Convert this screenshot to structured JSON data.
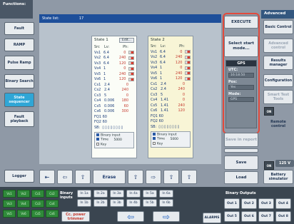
{
  "left_panel": {
    "title": "Functions:",
    "buttons": [
      "Fault",
      "RAMP",
      "Pulse Ramp",
      "Binary Search",
      "State sequencer",
      "Fault playback"
    ],
    "logger": "Logger"
  },
  "status_bar": {
    "label": "State list:",
    "value": "17"
  },
  "states": [
    {
      "title": "State 1",
      "edit": "Edit...",
      "headers": [
        "Src",
        "Lv:",
        "Ph:"
      ],
      "rows": [
        [
          "Vs1",
          "6.4",
          "0"
        ],
        [
          "Vs2",
          "6.4",
          "240"
        ],
        [
          "Vs3",
          "6.4",
          "120"
        ],
        [
          "Vs4",
          "1",
          "0"
        ],
        [
          "Vs5",
          "1",
          "240"
        ],
        [
          "Vs6",
          "1",
          "120"
        ],
        [
          "Cs1",
          "2.4",
          "0"
        ],
        [
          "Cs2",
          "2.4",
          "240"
        ],
        [
          "Cs3",
          "5",
          "0"
        ],
        [
          "Cs4",
          "0.006",
          "180"
        ],
        [
          "Cs5",
          "0.006",
          "60"
        ],
        [
          "Cs6",
          "0.006",
          "300"
        ]
      ],
      "fq": [
        "FQ1  60",
        "FQ2  60"
      ],
      "sb_label": "SB:",
      "binary_input": "Binary input",
      "time_label": "Time",
      "time_value": "5000",
      "key_label": "Key"
    },
    {
      "title": "State 2",
      "edit": "",
      "headers": [
        "Src",
        "Lv:",
        "Ph:"
      ],
      "rows": [
        [
          "Vs1",
          "6.4",
          "0"
        ],
        [
          "Vs2",
          "6.4",
          "240"
        ],
        [
          "Vs3",
          "6.4",
          "120"
        ],
        [
          "Vs4",
          "1",
          "0"
        ],
        [
          "Vs5",
          "1",
          "240"
        ],
        [
          "Vs6",
          "1",
          "120"
        ],
        [
          "Cs1",
          "2.4",
          "0"
        ],
        [
          "Cs2",
          "2.4",
          "240"
        ],
        [
          "Cs3",
          "5",
          "0"
        ],
        [
          "Cs4",
          "1.41",
          "0"
        ],
        [
          "Cs5",
          "1.41",
          "240"
        ],
        [
          "Cs6",
          "1.41",
          "120"
        ]
      ],
      "fq": [
        "FQ1  60",
        "FQ2  60"
      ],
      "sb_label": "SB:",
      "binary_input": "Binary input",
      "time_label": "Time",
      "time_value": "5000",
      "key_label": "Key"
    }
  ],
  "bottom_bar": {
    "erase": "Erase",
    "save": "Save",
    "load": "Load"
  },
  "right_panel": {
    "execute": "EXECUTE",
    "select_start": "Select start mode...",
    "gps_title": "GPS",
    "utc_label": "UTC:",
    "utc_value": "16:18:50",
    "pos_label": "Pos:",
    "pos_value": "Yes",
    "mode_label": "Mode:",
    "mode_value": "GPS",
    "save_report": "Save in report"
  },
  "advanced": {
    "title": "Advanced",
    "items": [
      "Basic Control",
      "Advanced control",
      "Results manager",
      "Configuration",
      "Smart Test Tools"
    ],
    "on1": "ON",
    "remote": "Remote control",
    "on2": "ON",
    "battery_value": "125 V",
    "battery": "Battery simulator"
  },
  "bottom_panel": {
    "green_buttons": [
      "Vs1",
      "Vs2",
      "Cs1",
      "Cs2",
      "Vs3",
      "Vs4",
      "Cs3",
      "Cs4",
      "Vs5",
      "Vs6",
      "Cs5",
      "Cs6"
    ],
    "binary_label": "Binary inputs",
    "inputs": [
      "In 1a",
      "In 2a",
      "In 3a",
      "In 4a",
      "In 5a",
      "In 6a",
      "In 1b",
      "In 2b",
      "In 3b",
      "In 4b",
      "In 5b",
      "In 6b"
    ],
    "cc_power": "Cc. power trimmer",
    "alarms": "ALARMS",
    "binary_outputs_label": "Binary Outputs",
    "outputs": [
      "Out 1",
      "Out 2",
      "Out 3",
      "Out 4",
      "Out 5",
      "Out 6",
      "Out 7",
      "Out 8"
    ]
  }
}
